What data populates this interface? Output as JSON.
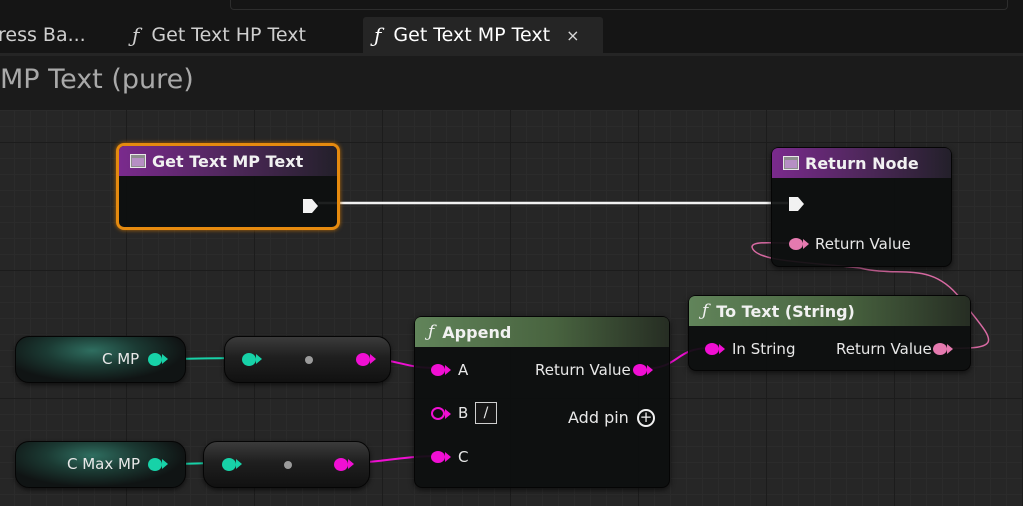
{
  "tabs": [
    {
      "label": "ress Ba...",
      "has_function_icon": false,
      "active": false
    },
    {
      "label": "Get Text HP Text",
      "has_function_icon": true,
      "active": false
    },
    {
      "label": "Get Text MP Text",
      "has_function_icon": true,
      "active": true,
      "close_glyph": "×"
    }
  ],
  "function_glyph": "ƒ",
  "graph_title": "MP Text (pure)",
  "nodes": {
    "entry": {
      "title": "Get Text MP Text",
      "selected": true,
      "icon": "function-entry-icon"
    },
    "return": {
      "title": "Return Node",
      "icon": "function-return-icon",
      "pin_return_value": "Return Value"
    },
    "append": {
      "title": "Append",
      "pin_a": "A",
      "pin_b": "B",
      "pin_b_value": "/",
      "pin_c": "C",
      "pin_return_value": "Return Value",
      "add_pin": "Add pin",
      "add_pin_glyph": "+"
    },
    "to_text": {
      "title": "To Text (String)",
      "pin_in": "In String",
      "pin_return_value": "Return Value"
    },
    "var_cmp": {
      "label": "C MP"
    },
    "var_cmaxmp": {
      "label": "C Max MP"
    }
  },
  "colors": {
    "string_pin": "#f00fd3",
    "text_pin": "#e57aaf",
    "integer_pin": "#17d2a8",
    "selected_outline": "#e58a0f",
    "function_header_purple": "#7a2a8d",
    "pure_function_header_green": "#61845a"
  }
}
